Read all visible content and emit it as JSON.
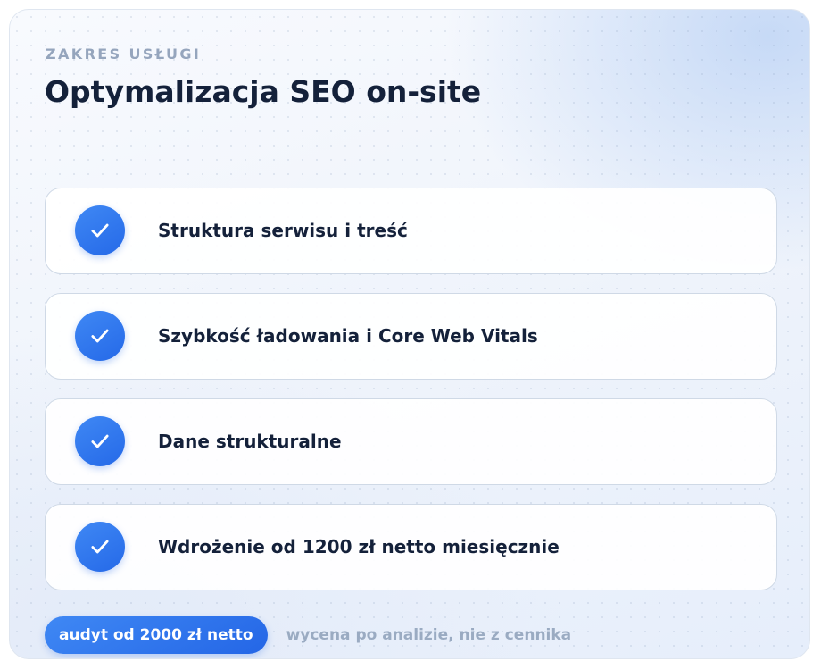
{
  "card": {
    "eyebrow": "ZAKRES USŁUGI",
    "title": "Optymalizacja SEO on-site"
  },
  "items": [
    {
      "label": "Struktura serwisu i treść",
      "icon": "check-icon"
    },
    {
      "label": "Szybkość ładowania i Core Web Vitals",
      "icon": "check-icon"
    },
    {
      "label": "Dane strukturalne",
      "icon": "check-icon"
    },
    {
      "label": "Wdrożenie od 1200 zł netto miesięcznie",
      "icon": "check-icon"
    }
  ],
  "footer": {
    "badge": "audyt od 2000 zł netto",
    "note": "wycena po analizie, nie z cennika"
  },
  "colors": {
    "accent": "#2f78ee",
    "title": "#14213a",
    "muted": "#95a5bd"
  }
}
